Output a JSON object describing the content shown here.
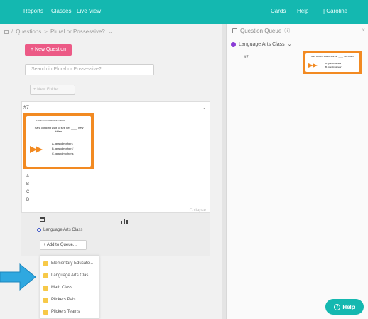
{
  "topbar": {
    "nav": [
      "Reports",
      "Classes",
      "Live View"
    ],
    "right": [
      "Cards",
      "Help",
      "| Caroline"
    ],
    "color": "#14b8b0"
  },
  "breadcrumb": {
    "root": "Questions",
    "separator": ">",
    "current": "Plural or Possessive?",
    "chevron": "⌄"
  },
  "library": {
    "new_question_label": "+ New Question",
    "new_question_color": "#ec5a86",
    "search_placeholder": "Search in Plural or Possessive?",
    "new_folder_label": "+ New Folder"
  },
  "question_card": {
    "number": "#7",
    "thumbnail": {
      "title": "Plural and Possessive Practice",
      "prompt": "Sara couldn't wait to see her ____ new kitten.",
      "options": [
        "A. grandmothers",
        "B. grandmothers'",
        "C. grandmother's"
      ]
    },
    "answers": [
      "A",
      "B",
      "C",
      "D"
    ],
    "collapse_label": "Collapse",
    "class_label": "Language Arts Class",
    "add_to_queue_label": "+ Add to Queue..."
  },
  "dropdown": {
    "items": [
      "Elementary Educato...",
      "Language Arts Clas...",
      "Math Class",
      "Plickers Pals",
      "Plickers Teams"
    ]
  },
  "queue_panel": {
    "title": "Question Queue",
    "info_icon": "ⓘ",
    "close_icon": "×",
    "class_name": "Language Arts Class",
    "class_color": "#8a3bd6",
    "question_number": "#7",
    "thumbnail": {
      "prompt": "Sara couldn't wait to see her ____ new kitten.",
      "options": [
        "A. grandmothers",
        "B. grandmothers'"
      ]
    }
  },
  "help_button": {
    "label": "Help",
    "icon": "?"
  }
}
